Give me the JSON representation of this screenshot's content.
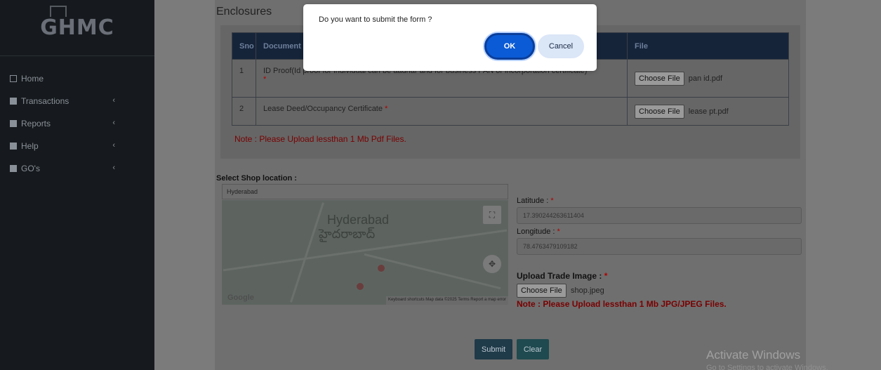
{
  "sidebar": {
    "logo_text": "GHMC",
    "items": [
      {
        "label": "Home"
      },
      {
        "label": "Transactions"
      },
      {
        "label": "Reports"
      },
      {
        "label": "Help"
      },
      {
        "label": "GO's"
      }
    ],
    "chevron": "‹"
  },
  "enclosures": {
    "title": "Enclosures",
    "headers": {
      "sno": "Sno",
      "document": "Document",
      "file": "File"
    },
    "rows": [
      {
        "sno": "1",
        "document": "ID Proof(Id proof for individual can be aadhar and for business PAN or incorporation certificate)",
        "required": "*",
        "file_button": "Choose File",
        "file_name": "pan id.pdf"
      },
      {
        "sno": "2",
        "document": "Lease Deed/Occupancy Certificate",
        "required": "*",
        "file_button": "Choose File",
        "file_name": "lease pt.pdf"
      }
    ],
    "note": "Note : Please Upload lessthan 1 Mb Pdf Files."
  },
  "location": {
    "label": "Select Shop location :",
    "search_value": "Hyderabad",
    "map": {
      "title": "Hyderabad",
      "title_telugu": "హైదరాబాద్",
      "google": "Google",
      "attribution": "Keyboard shortcuts   Map data ©2025   Terms   Report a map error"
    },
    "latitude_label": "Latitude :",
    "latitude_value": "17.390244263611404",
    "longitude_label": "Longitude :",
    "longitude_value": "78.4763479109182",
    "required": "*"
  },
  "trade_image": {
    "label": "Upload Trade Image :",
    "required": "*",
    "file_button": "Choose File",
    "file_name": "shop.jpeg",
    "note": "Note : Please Upload lessthan 1 Mb JPG/JPEG Files."
  },
  "buttons": {
    "submit": "Submit",
    "clear": "Clear"
  },
  "dialog": {
    "message": "Do you want to submit the form ?",
    "ok": "OK",
    "cancel": "Cancel"
  },
  "watermark": {
    "title": "Activate Windows",
    "subtitle": "Go to Settings to activate Windows."
  }
}
